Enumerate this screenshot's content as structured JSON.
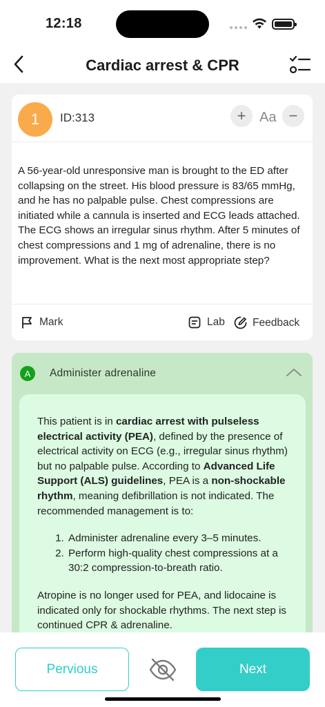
{
  "status": {
    "time": "12:18"
  },
  "header": {
    "title": "Cardiac arrest & CPR"
  },
  "question": {
    "number": "1",
    "id_label": "ID:313",
    "font_label": "Aa",
    "plus_symbol": "+",
    "minus_symbol": "−",
    "text": "A 56-year-old unresponsive man is brought to the ED after collapsing on the street. His blood pressure is 83/65 mmHg, and he has no palpable pulse. Chest compressions are initiated while a cannula is inserted and ECG leads attached. The ECG shows an irregular sinus rhythm. After 5 minutes of chest compressions and 1 mg of adrenaline, there is no improvement. What is the next most appropriate step?",
    "actions": {
      "mark": "Mark",
      "lab": "Lab",
      "feedback": "Feedback"
    }
  },
  "answer": {
    "letter": "A",
    "label": "Administer adrenaline",
    "explanation": {
      "p1_a": "This patient is in ",
      "p1_b": "cardiac arrest with pulseless electrical activity (PEA)",
      "p1_c": ", defined by the presence of electrical activity on ECG (e.g., irregular sinus rhythm) but no palpable pulse. According to ",
      "p1_d": "Advanced Life Support (ALS) guidelines",
      "p1_e": ", PEA is a ",
      "p1_f": "non-shockable rhythm",
      "p1_g": ", meaning defibrillation is not indicated. The recommended management is to:",
      "steps": [
        "Administer adrenaline every 3–5 minutes.",
        "Perform high-quality chest compressions at a 30:2 compression-to-breath ratio."
      ],
      "p2": "Atropine is no longer used for PEA, and lidocaine is indicated only for shockable rhythms. The next step is continued CPR & adrenaline."
    }
  },
  "footer": {
    "previous_label": "Pervious",
    "next_label": "Next"
  },
  "colors": {
    "accent": "#33cec8",
    "badge_orange": "#f9ab4b",
    "correct_green": "#14a01c",
    "answer_bg": "#c6e8c6",
    "explanation_bg": "#dcfbe2"
  },
  "icons": {
    "back": "chevron-left-icon",
    "list": "checklist-icon",
    "mark": "flag-icon",
    "lab": "lab-icon",
    "feedback": "feedback-edit-icon",
    "collapse": "chevron-up-icon",
    "hide": "eye-off-icon"
  }
}
